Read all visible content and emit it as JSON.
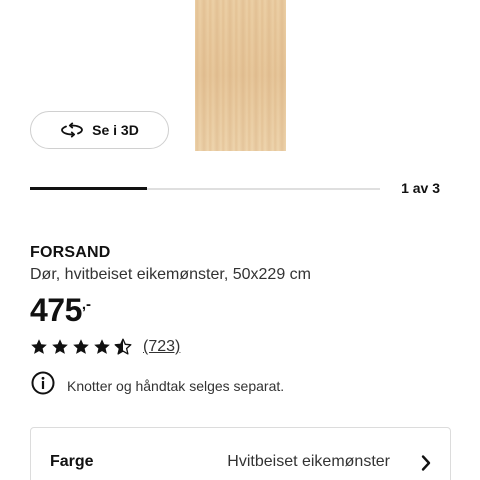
{
  "view3d": {
    "label": "Se i 3D",
    "icon": "rotate-3d-icon"
  },
  "carousel": {
    "counter": "1 av 3",
    "current": 1,
    "total": 3
  },
  "product": {
    "name": "FORSAND",
    "description": "Dør, hvitbeiset eikemønster, 50x229 cm",
    "price": {
      "amount": "475",
      "suffix": ",-"
    }
  },
  "rating": {
    "stars": 4.5,
    "max": 5,
    "count_text": "(723)"
  },
  "notice": {
    "icon": "info-icon",
    "text": "Knotter og håndtak selges separat."
  },
  "option": {
    "label": "Farge",
    "value": "Hvitbeiset eikemønster",
    "icon": "chevron-right-icon"
  },
  "colors": {
    "text": "#111111",
    "border": "#dcdcdc",
    "wood": "#e9cba0"
  }
}
